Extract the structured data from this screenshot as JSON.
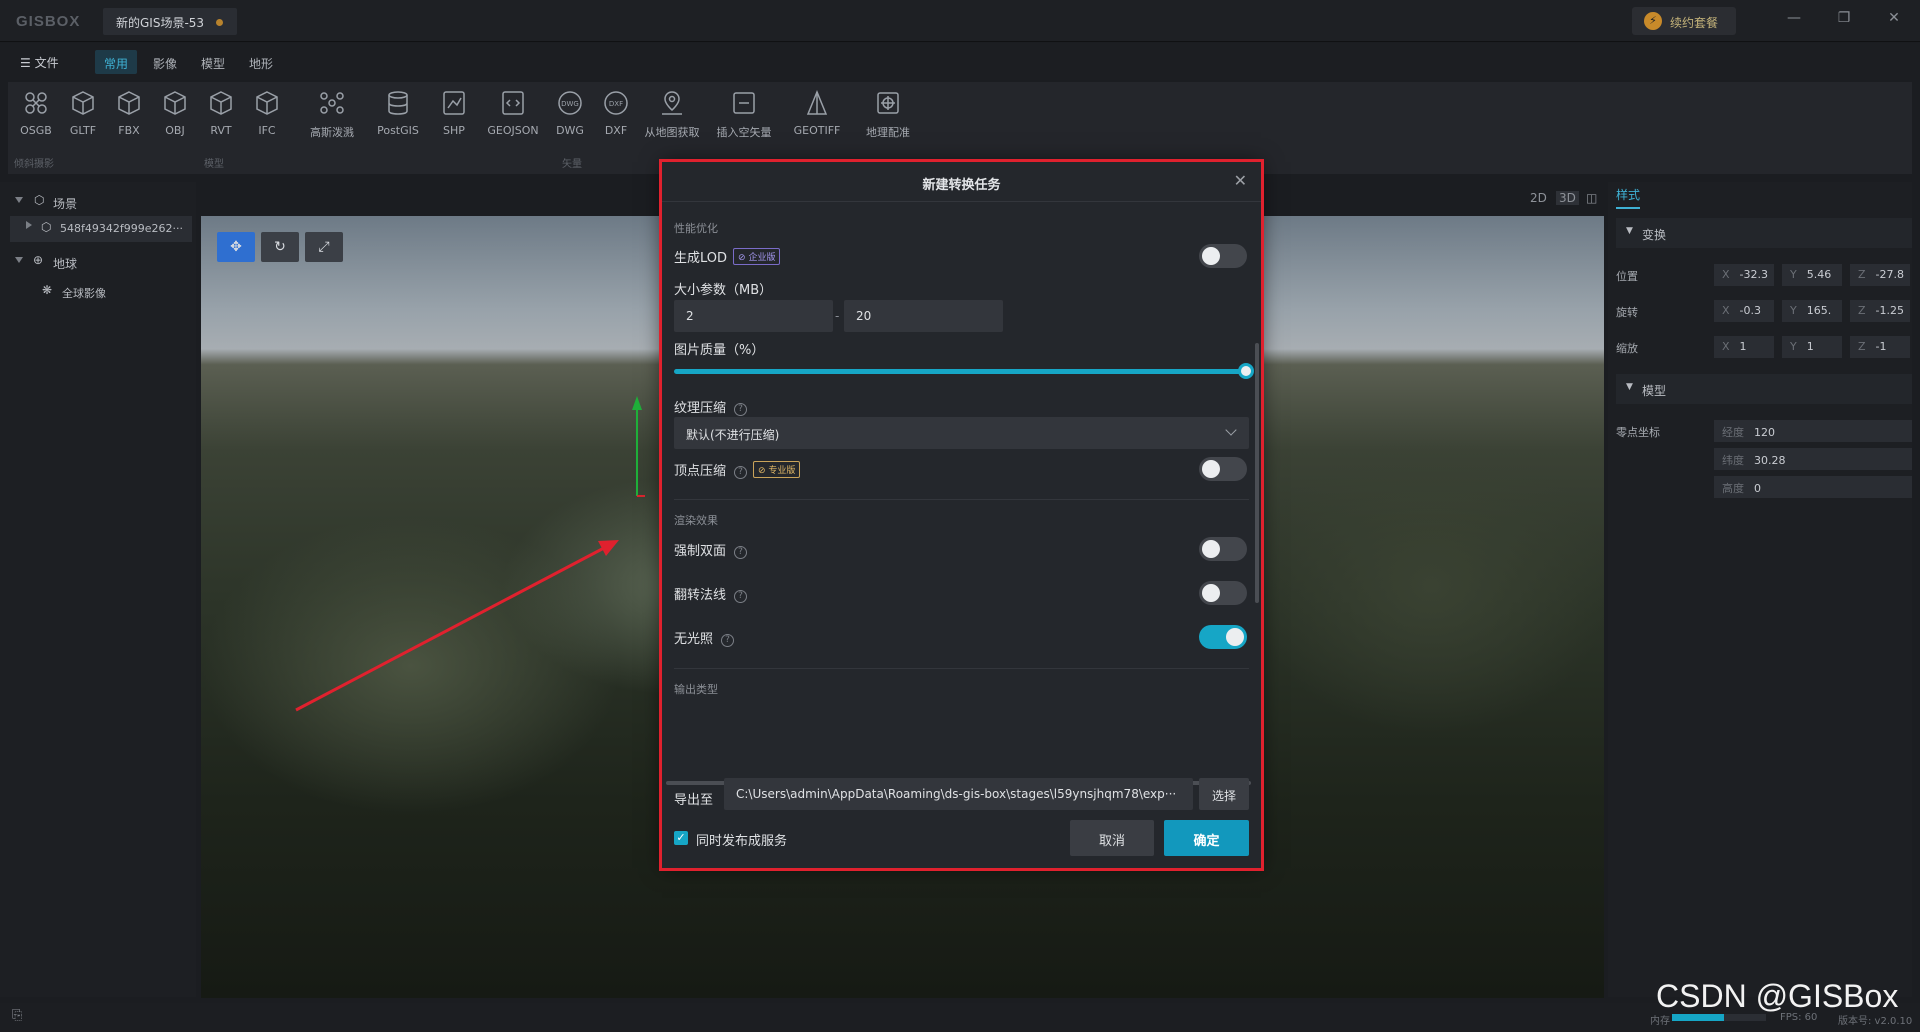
{
  "app": {
    "logo": "GISBOX",
    "doc_tab": "新的GIS场景-53",
    "renew_label": "续约套餐"
  },
  "menu": {
    "file": "文件",
    "tabs": [
      "常用",
      "影像",
      "模型",
      "地形"
    ],
    "active_tab": "常用"
  },
  "toolbar": {
    "tools": [
      {
        "label": "OSGB",
        "icon": "osgb-icon"
      },
      {
        "label": "GLTF",
        "icon": "cube-icon"
      },
      {
        "label": "FBX",
        "icon": "cube-icon"
      },
      {
        "label": "OBJ",
        "icon": "cube-icon"
      },
      {
        "label": "RVT",
        "icon": "cube-icon"
      },
      {
        "label": "IFC",
        "icon": "cube-icon"
      },
      {
        "label": "高斯泼溅",
        "icon": "gaussian-icon"
      },
      {
        "label": "PostGIS",
        "icon": "database-icon"
      },
      {
        "label": "SHP",
        "icon": "shp-icon"
      },
      {
        "label": "GEOJSON",
        "icon": "geojson-icon"
      },
      {
        "label": "DWG",
        "icon": "dwg-icon"
      },
      {
        "label": "DXF",
        "icon": "dxf-icon"
      },
      {
        "label": "从地图获取",
        "icon": "map-fetch-icon"
      },
      {
        "label": "插入空矢量",
        "icon": "insert-vector-icon"
      },
      {
        "label": "GEOTIFF",
        "icon": "geotiff-icon"
      },
      {
        "label": "地理配准",
        "icon": "georeference-icon"
      }
    ],
    "groups": [
      "倾斜摄影",
      "模型",
      "矢量"
    ]
  },
  "left_panel": {
    "scene_label": "场景",
    "scene_item": "548f49342f999e262···",
    "earth_label": "地球",
    "earth_item": "全球影像"
  },
  "view_modes": [
    "2D",
    "3D"
  ],
  "right_panel": {
    "tab": "样式",
    "transform_section": "变换",
    "position_label": "位置",
    "position": {
      "x": "-32.3",
      "y": "5.46",
      "z": "-27.8"
    },
    "rotation_label": "旋转",
    "rotation": {
      "x": "-0.3",
      "y": "165.",
      "z": "-1.25"
    },
    "scale_label": "缩放",
    "scale": {
      "x": "1",
      "y": "1",
      "z": "-1"
    },
    "model_section": "模型",
    "origin_label": "零点坐标",
    "longitude_label": "经度",
    "longitude": "120",
    "latitude_label": "纬度",
    "latitude": "30.28",
    "height_label": "高度",
    "height": "0"
  },
  "dialog": {
    "title": "新建转换任务",
    "perf_section": "性能优化",
    "lod_label": "生成LOD",
    "lod_badge": "企业版",
    "lod_on": false,
    "size_label": "大小参数（MB）",
    "size_min": "2",
    "size_max": "20",
    "quality_label": "图片质量（%）",
    "quality_value": 100,
    "texture_label": "纹理压缩",
    "texture_value": "默认(不进行压缩)",
    "vertex_label": "顶点压缩",
    "vertex_badge": "专业版",
    "vertex_on": false,
    "render_section": "渲染效果",
    "double_side_label": "强制双面",
    "double_side_on": false,
    "flip_normal_label": "翻转法线",
    "flip_normal_on": false,
    "no_light_label": "无光照",
    "no_light_on": true,
    "output_section": "输出类型",
    "export_label": "导出至",
    "export_path": "C:\\Users\\admin\\AppData\\Roaming\\ds-gis-box\\stages\\l59ynsjhqm78\\exp···",
    "choose_label": "选择",
    "publish_label": "同时发布成服务",
    "publish_checked": true,
    "cancel_label": "取消",
    "ok_label": "确定"
  },
  "status": {
    "memory_label": "内存",
    "fps": "FPS: 60",
    "version": "版本号: v2.0.10"
  },
  "watermark": "CSDN @GISBox",
  "colors": {
    "accent": "#16a6c6",
    "annotation": "#e0212e",
    "background": "#1b1d21"
  }
}
